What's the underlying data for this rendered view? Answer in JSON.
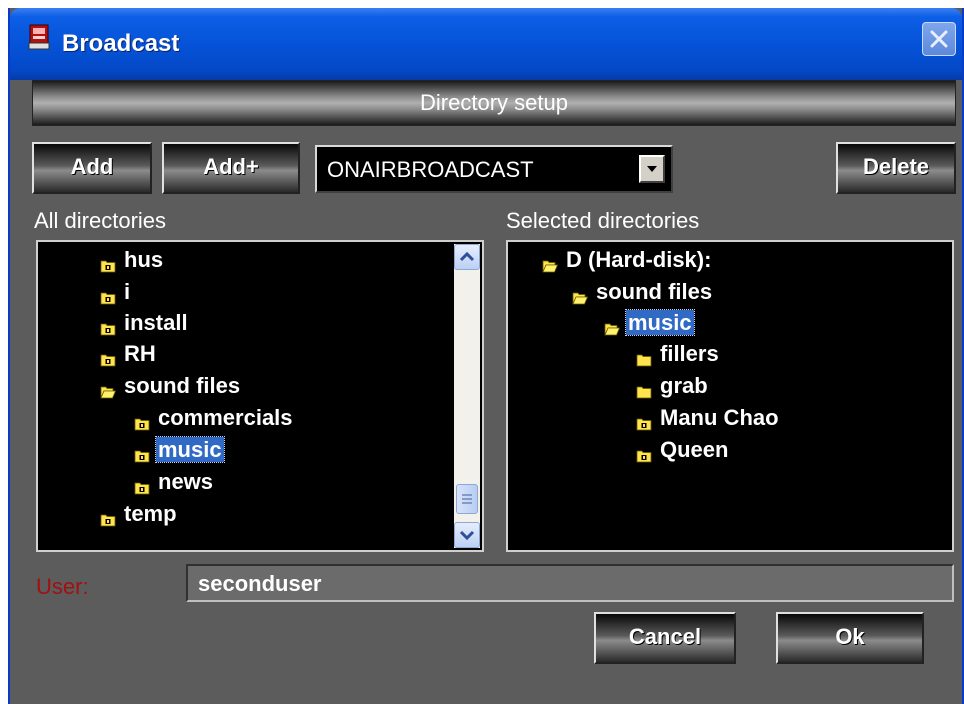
{
  "window": {
    "title": "Broadcast",
    "icon": "broadcast-app-icon",
    "close_icon": "close-icon"
  },
  "header": {
    "title": "Directory setup"
  },
  "toolbar": {
    "add_label": "Add",
    "add_plus_label": "Add+",
    "delete_label": "Delete",
    "profile_select": {
      "value": "ONAIRBROADCAST",
      "icon": "chevron-down-icon"
    }
  },
  "all_directories": {
    "label": "All directories",
    "items": [
      {
        "label": "hus",
        "icon": "folder-closed-icon",
        "selected": false
      },
      {
        "label": "i",
        "icon": "folder-closed-icon",
        "selected": false
      },
      {
        "label": "install",
        "icon": "folder-closed-icon",
        "selected": false
      },
      {
        "label": "RH",
        "icon": "folder-closed-icon",
        "selected": false
      },
      {
        "label": "sound files",
        "icon": "folder-open-icon",
        "selected": false
      },
      {
        "label": "commercials",
        "icon": "folder-closed-icon",
        "selected": false
      },
      {
        "label": "music",
        "icon": "folder-closed-icon",
        "selected": true
      },
      {
        "label": "news",
        "icon": "folder-closed-icon",
        "selected": false
      },
      {
        "label": "temp",
        "icon": "folder-closed-icon",
        "selected": false
      }
    ]
  },
  "selected_directories": {
    "label": "Selected directories",
    "items": [
      {
        "label": "D (Hard-disk):",
        "icon": "folder-open-icon",
        "selected": false
      },
      {
        "label": "sound files",
        "icon": "folder-open-icon",
        "selected": false
      },
      {
        "label": "music",
        "icon": "folder-open-icon",
        "selected": true
      },
      {
        "label": "fillers",
        "icon": "folder-filled-icon",
        "selected": false
      },
      {
        "label": "grab",
        "icon": "folder-filled-icon",
        "selected": false
      },
      {
        "label": "Manu Chao",
        "icon": "folder-closed-icon",
        "selected": false
      },
      {
        "label": "Queen",
        "icon": "folder-closed-icon",
        "selected": false
      }
    ]
  },
  "user": {
    "label": "User:",
    "value": "seconduser"
  },
  "footer": {
    "cancel_label": "Cancel",
    "ok_label": "Ok"
  },
  "colors": {
    "titlebar": "#0553d8",
    "selection": "#316ac5",
    "folder": "#ffe44d",
    "user_label": "#a21010",
    "background": "#5c5c5c"
  }
}
